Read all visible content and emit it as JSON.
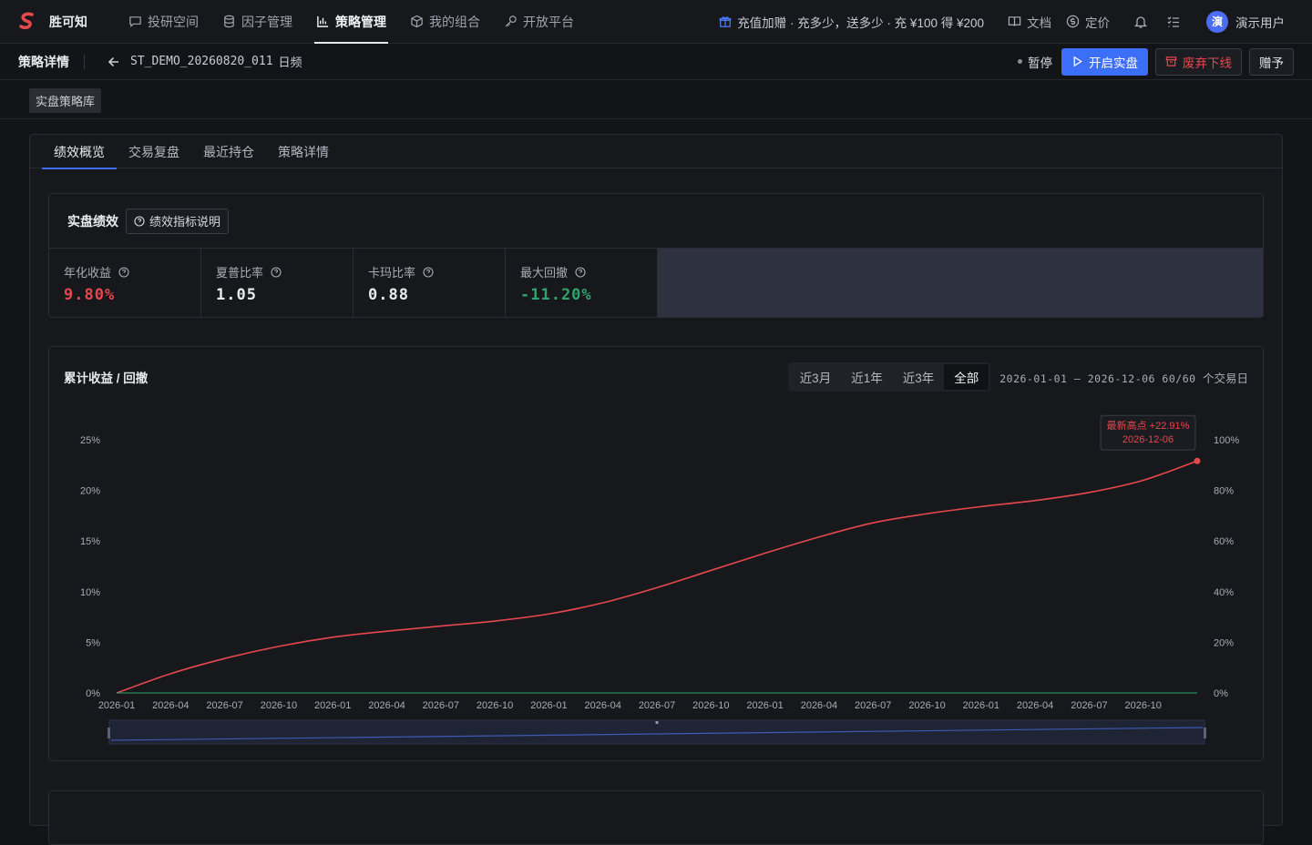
{
  "brand": {
    "name": "胜可知"
  },
  "nav": {
    "items": [
      {
        "label": "投研空间",
        "icon": "chat-icon"
      },
      {
        "label": "因子管理",
        "icon": "database-icon"
      },
      {
        "label": "策略管理",
        "icon": "bar-chart-icon",
        "active": true
      },
      {
        "label": "我的组合",
        "icon": "cube-icon"
      },
      {
        "label": "开放平台",
        "icon": "key-icon"
      }
    ],
    "promo": "充值加赠 · 充多少，送多少 · 充 ¥100 得 ¥200",
    "docs": "文档",
    "pricing": "定价",
    "user": {
      "avatar": "演",
      "name": "演示用户"
    }
  },
  "subbar": {
    "title": "策略详情",
    "strategy_id": "ST_DEMO_20260820_011",
    "frequency": "日频",
    "status": "暂停",
    "start_live": "开启实盘",
    "discard": "废弃下线",
    "gift": "赠予"
  },
  "crumb": {
    "tag": "实盘策略库"
  },
  "tabs": [
    "绩效概览",
    "交易复盘",
    "最近持仓",
    "策略详情"
  ],
  "performance": {
    "title": "实盘绩效",
    "help": "绩效指标说明",
    "metrics": [
      {
        "label": "年化收益",
        "value": "9.80%",
        "tone": "red"
      },
      {
        "label": "夏普比率",
        "value": "1.05",
        "tone": "neutral"
      },
      {
        "label": "卡玛比率",
        "value": "0.88",
        "tone": "neutral"
      },
      {
        "label": "最大回撤",
        "value": "-11.20%",
        "tone": "green"
      }
    ]
  },
  "chart": {
    "title": "累计收益 / 回撤",
    "ranges": [
      "近3月",
      "近1年",
      "近3年",
      "全部"
    ],
    "active_range": "全部",
    "date_range": "2026-01-01 – 2026-12-06",
    "days": "60/60",
    "days_unit": "个交易日",
    "tooltip": {
      "label": "最新高点 +22.91%",
      "date": "2026-12-06"
    }
  },
  "chart_data": {
    "type": "line",
    "title": "累计收益 / 回撤",
    "x_ticks": [
      "2026-01",
      "2026-04",
      "2026-07",
      "2026-10",
      "2026-01",
      "2026-04",
      "2026-07",
      "2026-10",
      "2026-01",
      "2026-04",
      "2026-07",
      "2026-10",
      "2026-01",
      "2026-04",
      "2026-07",
      "2026-10",
      "2026-01",
      "2026-04",
      "2026-07",
      "2026-10"
    ],
    "y_left_ticks": [
      "0%",
      "5%",
      "10%",
      "15%",
      "20%",
      "25%"
    ],
    "y_right_ticks": [
      "0%",
      "20%",
      "40%",
      "60%",
      "80%",
      "100%"
    ],
    "ylim_left": [
      0,
      25
    ],
    "ylim_right": [
      0,
      100
    ],
    "series": [
      {
        "name": "",
        "color": "#e5484d",
        "values": [
          0.0,
          1.9,
          3.4,
          4.6,
          5.5,
          6.1,
          6.6,
          7.1,
          7.8,
          8.9,
          10.4,
          12.1,
          13.8,
          15.4,
          16.8,
          17.7,
          18.4,
          19.0,
          19.8,
          21.0,
          22.91
        ]
      },
      {
        "name": "",
        "color": "#30a46c",
        "axis": "right",
        "values": [
          0,
          0,
          0,
          0,
          0,
          0,
          0,
          0,
          0,
          0,
          0,
          0,
          0,
          0,
          0,
          0,
          0,
          0,
          0,
          0,
          0
        ]
      }
    ],
    "grid": false,
    "legend": "none"
  }
}
